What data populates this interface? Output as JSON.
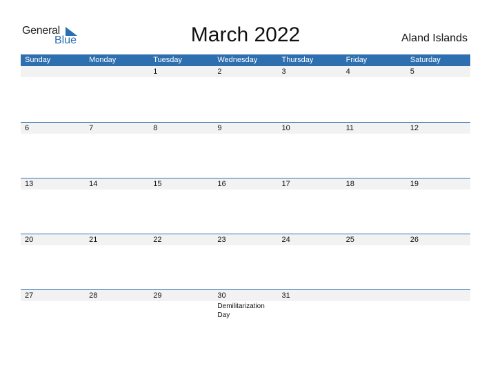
{
  "logo": {
    "general": "General",
    "blue": "Blue"
  },
  "title": "March 2022",
  "country": "Aland Islands",
  "weekdays": [
    "Sunday",
    "Monday",
    "Tuesday",
    "Wednesday",
    "Thursday",
    "Friday",
    "Saturday"
  ],
  "weeks": [
    {
      "days": [
        "",
        "",
        "1",
        "2",
        "3",
        "4",
        "5"
      ]
    },
    {
      "days": [
        "6",
        "7",
        "8",
        "9",
        "10",
        "11",
        "12"
      ]
    },
    {
      "days": [
        "13",
        "14",
        "15",
        "16",
        "17",
        "18",
        "19"
      ]
    },
    {
      "days": [
        "20",
        "21",
        "22",
        "23",
        "24",
        "25",
        "26"
      ]
    },
    {
      "days": [
        "27",
        "28",
        "29",
        "30",
        "31",
        "",
        ""
      ]
    }
  ],
  "holidays": [
    {
      "date": "30",
      "name": "Demilitarization Day"
    }
  ],
  "colors": {
    "accent": "#2e6fb0",
    "strip": "#f2f2f2"
  }
}
